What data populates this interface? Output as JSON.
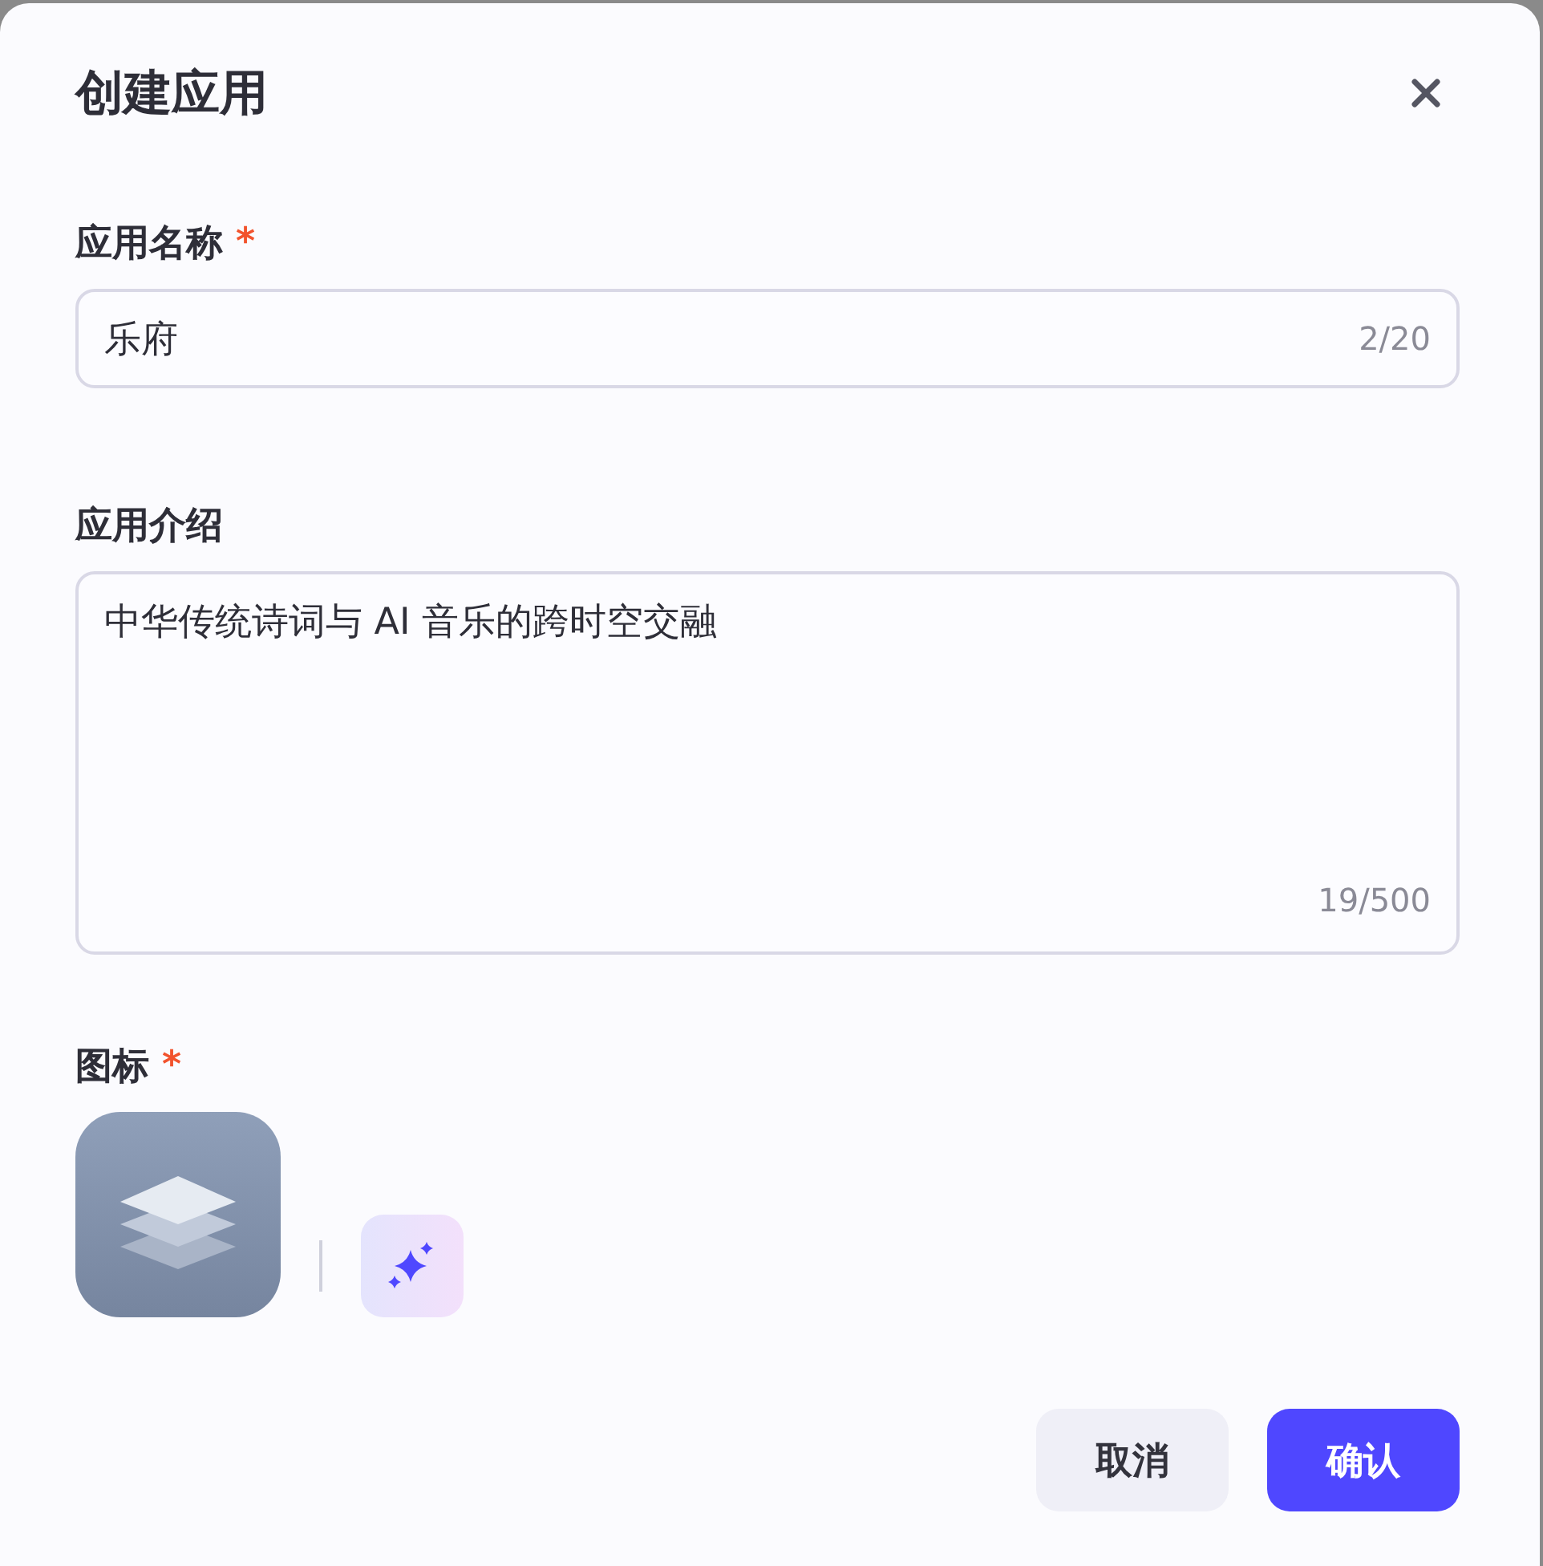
{
  "dialog": {
    "title": "创建应用"
  },
  "fields": [
    {
      "kind": "input",
      "label": "应用名称",
      "required": true,
      "value": "乐府",
      "counter": "2/20"
    },
    {
      "kind": "textarea",
      "label": "应用介绍",
      "required": false,
      "value": "中华传统诗词与 AI 音乐的跨时空交融",
      "counter": "19/500"
    }
  ],
  "icon_field": {
    "label": "图标",
    "required": true,
    "required_mark": "*"
  },
  "buttons": [
    {
      "kind": "secondary",
      "label": "取消"
    },
    {
      "kind": "primary",
      "label": "确认"
    }
  ]
}
